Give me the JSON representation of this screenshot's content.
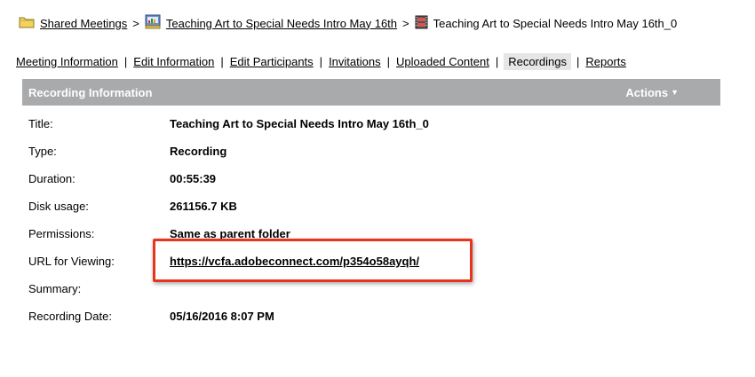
{
  "breadcrumb": {
    "items": [
      {
        "label": "Shared Meetings",
        "icon": "folder-icon",
        "link": true
      },
      {
        "label": "Teaching Art to Special Needs Intro May 16th",
        "icon": "meeting-icon",
        "link": true
      },
      {
        "label": "Teaching Art to Special Needs Intro May 16th_0",
        "icon": "recording-icon",
        "link": false
      }
    ],
    "separator": ">"
  },
  "tabs": [
    {
      "label": "Meeting Information"
    },
    {
      "label": "Edit Information"
    },
    {
      "label": "Edit Participants"
    },
    {
      "label": "Invitations"
    },
    {
      "label": "Uploaded Content"
    },
    {
      "label": "Recordings",
      "active": true
    },
    {
      "label": "Reports"
    }
  ],
  "tab_separator": "|",
  "panel": {
    "title": "Recording Information",
    "actions_label": "Actions",
    "rows": [
      {
        "label": "Title:",
        "value": "Teaching Art to Special Needs Intro May 16th_0"
      },
      {
        "label": "Type:",
        "value": "Recording"
      },
      {
        "label": "Duration:",
        "value": "00:55:39"
      },
      {
        "label": "Disk usage:",
        "value": "261156.7 KB"
      },
      {
        "label": "Permissions:",
        "value": "Same as parent folder"
      },
      {
        "label": "URL for Viewing:",
        "value": "https://vcfa.adobeconnect.com/p354o58ayqh/"
      },
      {
        "label": "Summary:",
        "value": ""
      },
      {
        "label": "Recording Date:",
        "value": "05/16/2016 8:07 PM"
      }
    ]
  },
  "colors": {
    "header_bg": "#a8aaab",
    "highlight": "#e8341d",
    "active_tab_bg": "#e6e6e6"
  }
}
